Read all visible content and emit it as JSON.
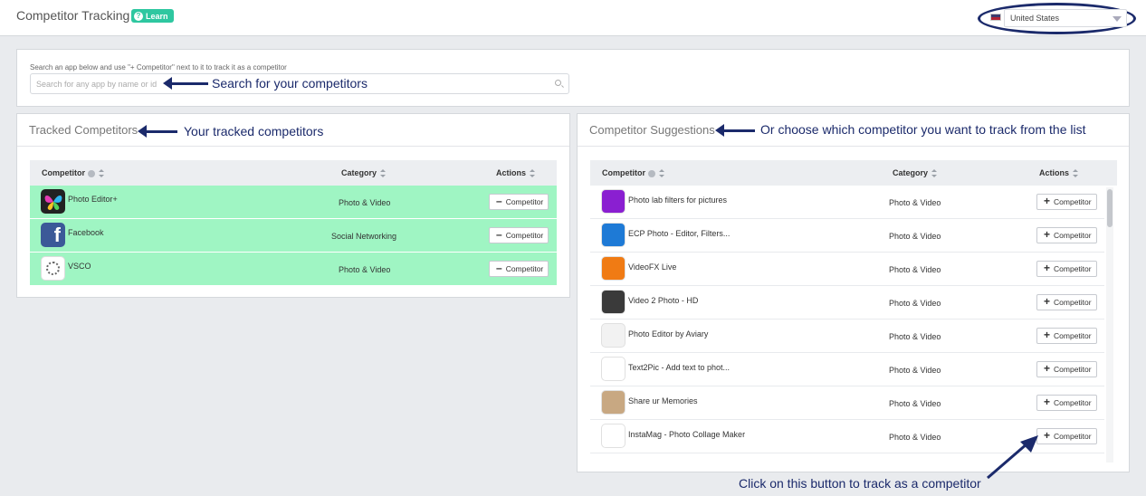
{
  "header": {
    "title": "Competitor Tracking",
    "learn_label": "Learn",
    "country": "United States"
  },
  "search": {
    "hint": "Search an app below and use \"+ Competitor\" next to it to track it as a competitor",
    "placeholder": "Search for any app by name or id"
  },
  "annotations": {
    "search": "Search for your competitors",
    "tracked": "Your tracked competitors",
    "suggestions": "Or choose which competitor you want to track from the list",
    "button": "Click on this button to track as a competitor"
  },
  "tracked": {
    "title": "Tracked Competitors",
    "columns": [
      "Competitor",
      "Category",
      "Actions"
    ],
    "rows": [
      {
        "name": "Photo Editor+",
        "category": "Photo & Video",
        "icon": "butterfly-icon",
        "action": "Competitor"
      },
      {
        "name": "Facebook",
        "category": "Social Networking",
        "icon": "facebook-icon",
        "action": "Competitor"
      },
      {
        "name": "VSCO",
        "category": "Photo & Video",
        "icon": "vsco-icon",
        "action": "Competitor"
      }
    ]
  },
  "suggestions": {
    "title": "Competitor Suggestions",
    "columns": [
      "Competitor",
      "Category",
      "Actions"
    ],
    "rows": [
      {
        "name": "Photo lab filters for pictures",
        "category": "Photo & Video",
        "icon": "photo-lab-icon",
        "color": "#8a1fd1",
        "action": "Competitor"
      },
      {
        "name": "ECP Photo - Editor, Filters...",
        "category": "Photo & Video",
        "icon": "ecp-icon",
        "color": "#1e7ad6",
        "action": "Competitor"
      },
      {
        "name": "VideoFX Live",
        "category": "Photo & Video",
        "icon": "fx-icon",
        "color": "#f07b14",
        "action": "Competitor"
      },
      {
        "name": "Video 2 Photo - HD",
        "category": "Photo & Video",
        "icon": "video2photo-icon",
        "color": "#3a3a3a",
        "action": "Competitor"
      },
      {
        "name": "Photo Editor by Aviary",
        "category": "Photo & Video",
        "icon": "aviary-icon",
        "color": "#f2f2f2",
        "action": "Competitor"
      },
      {
        "name": "Text2Pic - Add text to phot...",
        "category": "Photo & Video",
        "icon": "text2pic-icon",
        "color": "#ffffff",
        "action": "Competitor"
      },
      {
        "name": "Share ur Memories",
        "category": "Photo & Video",
        "icon": "memories-icon",
        "color": "#c8a882",
        "action": "Competitor"
      },
      {
        "name": "InstaMag - Photo Collage Maker",
        "category": "Photo & Video",
        "icon": "instamag-icon",
        "color": "#ffffff",
        "action": "Competitor"
      }
    ]
  }
}
